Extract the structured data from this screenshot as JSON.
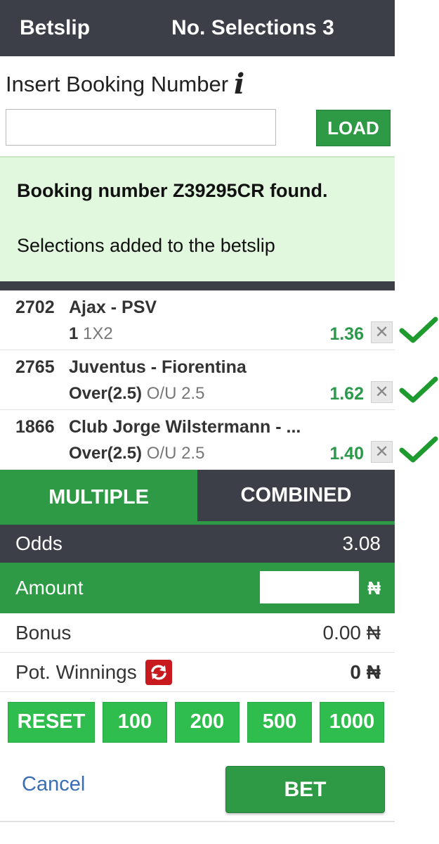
{
  "header": {
    "title": "Betslip",
    "selections_text": "No. Selections 3"
  },
  "booking": {
    "label": "Insert Booking Number",
    "info_icon": "info-icon",
    "input_value": "",
    "load_label": "LOAD"
  },
  "message": {
    "found": "Booking number Z39295CR found.",
    "added": "Selections added to the betslip"
  },
  "selections": [
    {
      "code": "2702",
      "match": "Ajax - PSV",
      "pick": "1",
      "market": "1X2",
      "odd": "1.36"
    },
    {
      "code": "2765",
      "match": "Juventus - Fiorentina",
      "pick": "Over(2.5)",
      "market": "O/U 2.5",
      "odd": "1.62"
    },
    {
      "code": "1866",
      "match": "Club Jorge Wilstermann - ...",
      "pick": "Over(2.5)",
      "market": "O/U 2.5",
      "odd": "1.40"
    }
  ],
  "remove_glyph": "✕",
  "tabs": {
    "multiple": "MULTIPLE",
    "combined": "COMBINED"
  },
  "summary": {
    "odds_label": "Odds",
    "odds_value": "3.08",
    "amount_label": "Amount",
    "amount_value": "",
    "currency": "₦",
    "bonus_label": "Bonus",
    "bonus_value": "0.00 ₦",
    "pot_label": "Pot. Winnings",
    "pot_value": "0 ₦"
  },
  "stakes": [
    "RESET",
    "100",
    "200",
    "500",
    "1000"
  ],
  "actions": {
    "cancel": "Cancel",
    "bet": "BET"
  },
  "colors": {
    "header_bg": "#3d3f48",
    "primary_green": "#2f9a46",
    "odd_green": "#2a9a4a",
    "stake_green": "#2fbe4e",
    "found_bg": "#e1f7de",
    "link_blue": "#3b6fb5",
    "refresh_red": "#c8191e",
    "check_green": "#1f9a2e"
  }
}
